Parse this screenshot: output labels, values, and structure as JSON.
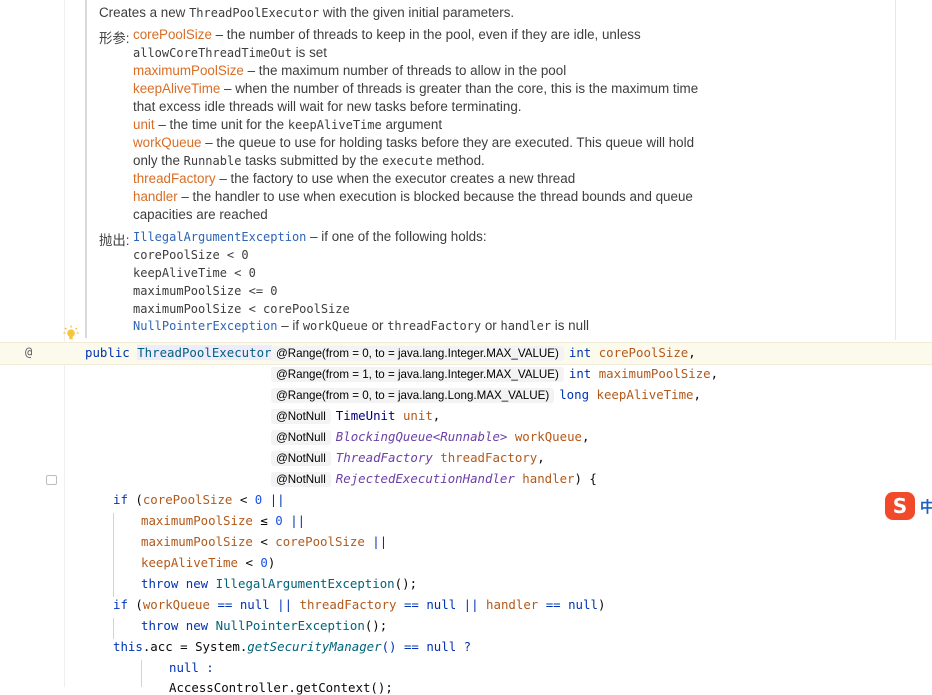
{
  "doc": {
    "intro_pre": "Creates a new ",
    "intro_class": "ThreadPoolExecutor",
    "intro_post": " with the given initial parameters.",
    "params_label": "形参:",
    "p1_name": "corePoolSize",
    "p1_desc": " – the number of threads to keep in the pool, even if they are idle, unless",
    "p1_code": "allowCoreThreadTimeOut",
    "p1_tail": " is set",
    "p2_name": "maximumPoolSize",
    "p2_desc": " – the maximum number of threads to allow in the pool",
    "p3_name": "keepAliveTime",
    "p3_desc": " – when the number of threads is greater than the core, this is the maximum time",
    "p3_desc2": "that excess idle threads will wait for new tasks before terminating.",
    "p4_name": "unit",
    "p4_desc": " – the time unit for the ",
    "p4_code": "keepAliveTime",
    "p4_tail": " argument",
    "p5_name": "workQueue",
    "p5_desc": " – the queue to use for holding tasks before they are executed. This queue will hold",
    "p5_desc2a": "only the ",
    "p5_code1": "Runnable",
    "p5_desc2b": " tasks submitted by the ",
    "p5_code2": "execute",
    "p5_desc2c": " method.",
    "p6_name": "threadFactory",
    "p6_desc": " – the factory to use when the executor creates a new thread",
    "p7_name": "handler",
    "p7_desc": " – the handler to use when execution is blocked because the thread bounds and queue",
    "p7_desc2": "capacities are reached",
    "throws_label": "抛出:",
    "t1_link": "IllegalArgumentException",
    "t1_desc": " – if one of the following holds:",
    "t1_c1": "corePoolSize < 0",
    "t1_c2": "keepAliveTime < 0",
    "t1_c3": "maximumPoolSize <= 0",
    "t1_c4": "maximumPoolSize < corePoolSize",
    "t2_link": "NullPointerException",
    "t2_desc_a": " – if ",
    "t2_code1": "workQueue",
    "t2_desc_b": " or ",
    "t2_code2": "threadFactory",
    "t2_desc_c": " or ",
    "t2_code3": "handler",
    "t2_desc_d": " is null"
  },
  "gutter": {
    "at_symbol": "@",
    "bulb_icon": "lightbulb-icon"
  },
  "code": {
    "l1_public": "public ",
    "l1_class": "ThreadPoolExecutor",
    "l1_paren": "(",
    "ann_range1": "@Range(from = 0, to = java.lang.Integer.MAX_VALUE)",
    "ann_range2": "@Range(from = 1, to = java.lang.Integer.MAX_VALUE)",
    "ann_range3": "@Range(from = 0, to = java.lang.Long.MAX_VALUE)",
    "ann_notnull": "@NotNull",
    "l1_type": "int ",
    "l1_par": "corePoolSize",
    "l2_type": "int ",
    "l2_par": "maximumPoolSize",
    "l3_type": "long ",
    "l3_par": "keepAliveTime",
    "l4_type": "TimeUnit ",
    "l4_par": "unit",
    "l5_type": "BlockingQueue",
    "l5_gen": "<Runnable>",
    "l5_par": " workQueue",
    "l6_type": "ThreadFactory ",
    "l6_par": "threadFactory",
    "l7_type": "RejectedExecutionHandler ",
    "l7_par": "handler",
    "l7_end": ") {",
    "comma": ",",
    "if1_kw": "if",
    "if1_open": " (",
    "if1_a": "corePoolSize",
    "if1_b": " < ",
    "zero": "0",
    "or": " ||",
    "c2_a": "maximumPoolSize",
    "c2_b": " ≤ ",
    "c3_a": "maximumPoolSize",
    "c3_b": " < ",
    "c3_c": "corePoolSize",
    "c4_a": "keepAliveTime",
    "c4_b": " < ",
    "c4_end": ")",
    "throw_kw": "throw new ",
    "iae": "IllegalArgumentException",
    "call_end": "();",
    "if2_kw": "if",
    "if2_open": " (",
    "if2_a": "workQueue",
    "eqnull": " == null",
    "or2": " || ",
    "if2_b": "threadFactory",
    "if2_c": "handler",
    "if2_end": ")",
    "npe": "NullPointerException",
    "this_kw": "this",
    "acc_a": ".acc = ",
    "system": "System",
    "dot": ".",
    "getsm": "getSecurityManager",
    "tern": "() == null ?",
    "null_kw": "null",
    "colon": " :",
    "last_line": "AccessController.getContext();"
  },
  "ime": {
    "logo_label": "S",
    "mode_label": "中"
  }
}
